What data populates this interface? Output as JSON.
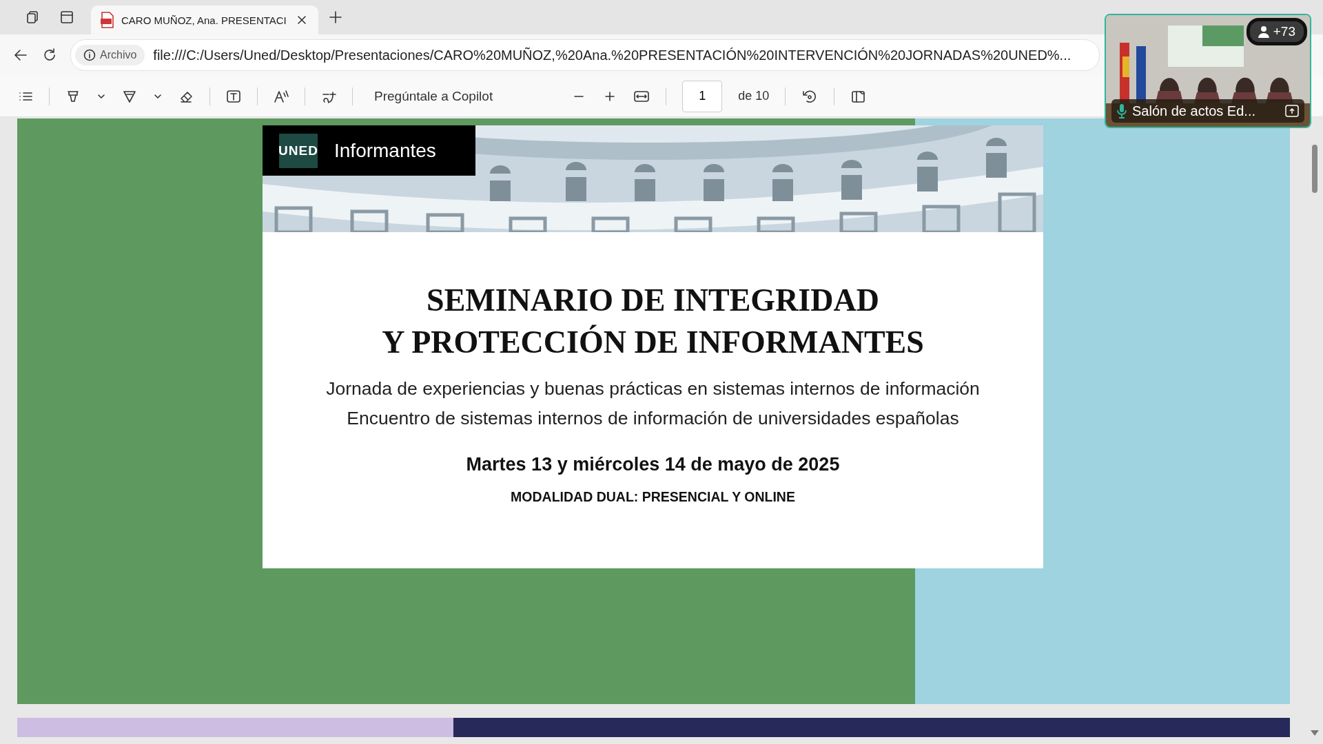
{
  "browser": {
    "tabs": [
      {
        "title": "CARO MUÑOZ, Ana. PRESENTACI",
        "selected": true
      }
    ],
    "address": {
      "security_label": "Archivo",
      "url": "file:///C:/Users/Uned/Desktop/Presentaciones/CARO%20MUÑOZ,%20Ana.%20PRESENTACIÓN%20INTERVENCIÓN%20JORNADAS%20UNED%..."
    }
  },
  "pdf_toolbar": {
    "copilot_label": "Pregúntale a Copilot",
    "page_number": "1",
    "page_total": "de 10"
  },
  "slide": {
    "logo_text": "UNED",
    "badge_label": "Informantes",
    "title_lines": [
      "SEMINARIO DE INTEGRIDAD",
      "Y PROTECCIÓN DE INFORMANTES"
    ],
    "subtitle_lines": [
      "Jornada de experiencias y buenas prácticas en sistemas internos de información",
      "Encuentro de sistemas internos de información de universidades españolas"
    ],
    "date": "Martes 13 y miércoles 14 de mayo de 2025",
    "modality": "MODALIDAD DUAL: PRESENCIAL Y ONLINE"
  },
  "video_call": {
    "participant_count": "+73",
    "room_name": "Salón de actos Ed..."
  }
}
